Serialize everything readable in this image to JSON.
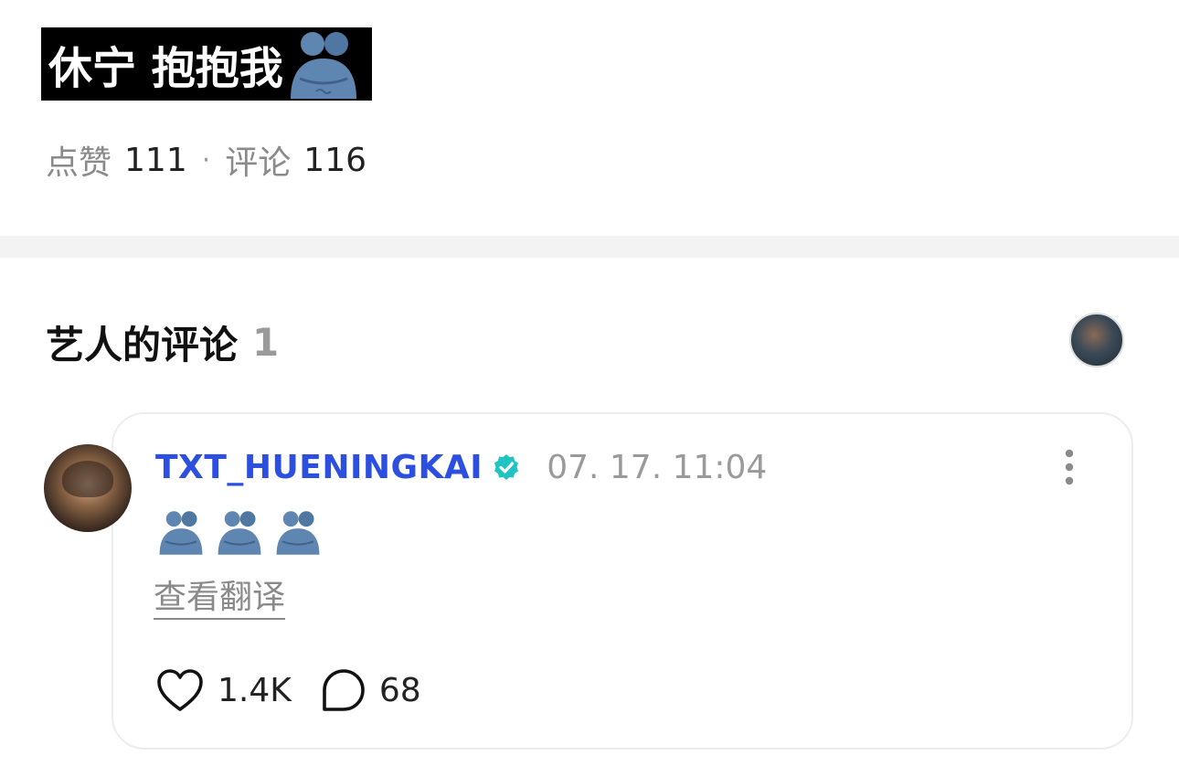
{
  "post": {
    "title": "休宁 抱抱我",
    "title_emoji": "hugging-people-icon",
    "like_label": "点赞",
    "like_count": "111",
    "separator": "·",
    "comment_label": "评论",
    "comment_count": "116"
  },
  "artist_comments": {
    "title": "艺人的评论",
    "count": "1"
  },
  "comment": {
    "author": "TXT_HUENINGKAI",
    "verified": true,
    "timestamp": "07. 17. 11:04",
    "emoji_icons": [
      "hugging-people-icon",
      "hugging-people-icon",
      "hugging-people-icon"
    ],
    "translate_label": "查看翻译",
    "likes": "1.4K",
    "replies": "68"
  },
  "colors": {
    "author_blue": "#2c4fe0",
    "verified_teal": "#1fc3c3",
    "emoji_blue": "#5f86b0"
  }
}
